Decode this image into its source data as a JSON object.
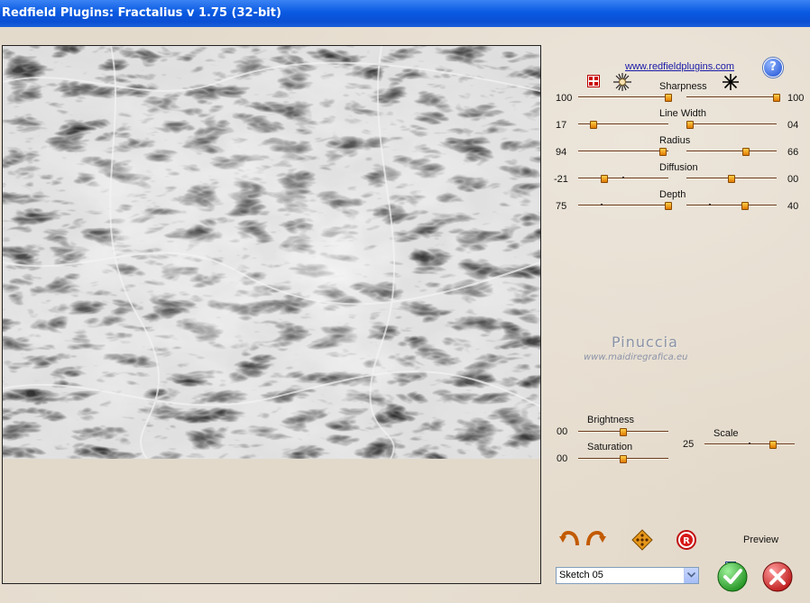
{
  "window": {
    "title": "Redfield Plugins: Fractalius v 1.75 (32-bit)"
  },
  "header": {
    "link": "www.redfieldplugins.com",
    "help": "?"
  },
  "sliders": {
    "sharpness": {
      "label": "Sharpness",
      "left_value": "100",
      "right_value": "100",
      "left_level": 1.0,
      "right_level": 1.0
    },
    "line_width": {
      "label": "Line Width",
      "left_value": "17",
      "right_value": "04",
      "left_level": 0.17,
      "right_level": 0.04
    },
    "radius": {
      "label": "Radius",
      "left_value": "94",
      "right_value": "66",
      "left_level": 0.94,
      "right_level": 0.66
    },
    "diffusion": {
      "label": "Diffusion",
      "left_value": "-21",
      "right_value": "00",
      "left_level": 0.29,
      "right_level": 0.5
    },
    "depth": {
      "label": "Depth",
      "left_value": "75",
      "right_value": "40",
      "left_level": 1.0,
      "right_level": 0.65
    },
    "brightness": {
      "label": "Brightness",
      "value": "00",
      "level": 0.5
    },
    "saturation": {
      "label": "Saturation",
      "value": "00",
      "level": 0.5
    },
    "scale": {
      "label": "Scale",
      "value": "25",
      "level": 0.76
    }
  },
  "watermark": {
    "name": "Pinuccia",
    "site": "www.maidiregrafica.eu"
  },
  "controls": {
    "preview_label": "Preview",
    "preview_checked": true,
    "preset": "Sketch 05"
  },
  "icons": [
    "grid-icon",
    "starburst-icon",
    "asterisk-icon",
    "undo-icon",
    "redo-icon",
    "random-icon",
    "reset-icon",
    "ok-icon",
    "cancel-icon"
  ],
  "colors": {
    "titlebar": "#0a5ae2",
    "thumb": "#f0a020",
    "ok": "#2ca02c",
    "cancel": "#d62020"
  }
}
